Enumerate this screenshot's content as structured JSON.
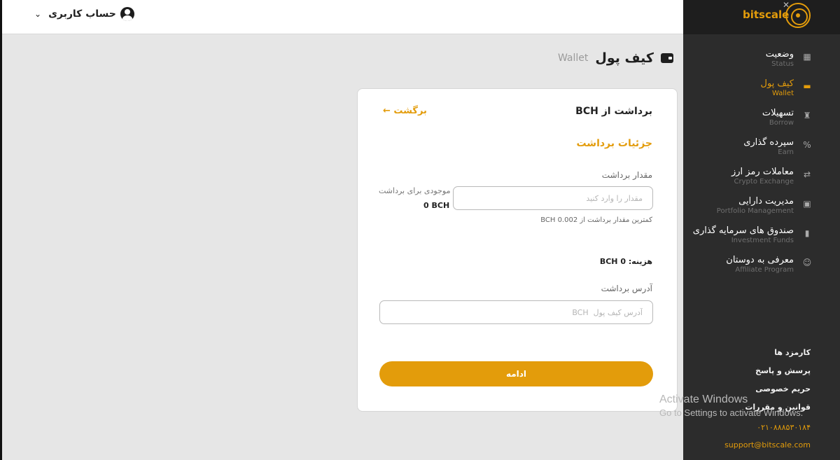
{
  "header": {
    "account_label": "حساب کاربری",
    "chevron": "⌄"
  },
  "brand": {
    "name": "bitscale",
    "accent": "#e39c0b"
  },
  "sidebar": {
    "items": [
      {
        "fa": "وضعیت",
        "en": "Status",
        "icon": "status-icon",
        "glyph": "▦",
        "active": false
      },
      {
        "fa": "کیف پول",
        "en": "Wallet",
        "icon": "wallet-icon",
        "glyph": "▬",
        "active": true
      },
      {
        "fa": "تسهیلات",
        "en": "Borrow",
        "icon": "money-bag-icon",
        "glyph": "♜",
        "active": false
      },
      {
        "fa": "سپرده گذاری",
        "en": "Earn",
        "icon": "percent-icon",
        "glyph": "%",
        "active": false
      },
      {
        "fa": "معاملات رمز ارز",
        "en": "Crypto Exchange",
        "icon": "exchange-icon",
        "glyph": "⇄",
        "active": false
      },
      {
        "fa": "مدیریت دارایی",
        "en": "Portfolio Management",
        "icon": "briefcase-icon",
        "glyph": "▣",
        "active": false
      },
      {
        "fa": "صندوق های سرمایه گذاری",
        "en": "Investment Funds",
        "icon": "bar-chart-icon",
        "glyph": "▮",
        "active": false
      },
      {
        "fa": "معرفی به دوستان",
        "en": "Affiliate Program",
        "icon": "users-icon",
        "glyph": "☺",
        "active": false
      }
    ],
    "footer_links": [
      "کارمزد ها",
      "پرسش و پاسخ",
      "حریم خصوصی",
      "قوانین و مقررات"
    ],
    "phone": "۰۲۱۰۸۸۸۵۳۰۱۸۴",
    "email": "support@bitscale.com"
  },
  "page": {
    "title_fa": "کیف پول",
    "title_en": "Wallet"
  },
  "withdraw": {
    "title": "برداشت از  BCH",
    "back_label": "برگشت ←",
    "section_title": "جزئیات برداشت",
    "amount_label": "مقدار برداشت",
    "amount_placeholder": "مقدار را وارد کنید",
    "amount_value": "",
    "balance_label": "موجودی برای برداشت",
    "balance_value": "0 BCH",
    "min_note": "کمترین مقدار برداشت از  0.002  BCH",
    "fee": "هزینه:  0 BCH",
    "address_label": "آدرس برداشت",
    "address_placeholder": "آدرس کیف پول  BCH",
    "address_value": "",
    "continue_label": "ادامه"
  },
  "watermark": {
    "line1": "Activate Windows",
    "line2": "Go to Settings to activate Windows."
  }
}
